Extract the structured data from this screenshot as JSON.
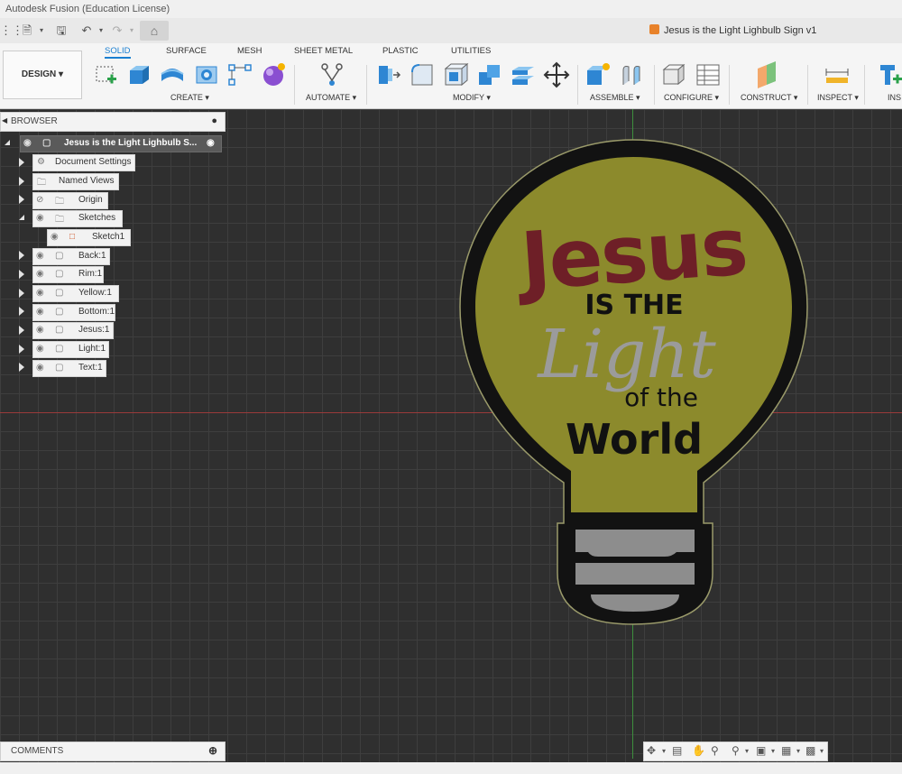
{
  "app": {
    "title": "Autodesk Fusion (Education License)"
  },
  "document": {
    "title": "Jesus is the Light Lighbulb Sign v1"
  },
  "workspace": {
    "label": "DESIGN ▾"
  },
  "tabs": [
    "SOLID",
    "SURFACE",
    "MESH",
    "SHEET METAL",
    "PLASTIC",
    "UTILITIES"
  ],
  "active_tab": "SOLID",
  "groups": {
    "create": "CREATE ▾",
    "automate": "AUTOMATE ▾",
    "modify": "MODIFY ▾",
    "assemble": "ASSEMBLE ▾",
    "configure": "CONFIGURE ▾",
    "construct": "CONSTRUCT ▾",
    "inspect": "INSPECT ▾",
    "insert": "INS"
  },
  "browser": {
    "header": "BROWSER",
    "root": "Jesus is the Light Lighbulb S...",
    "items": {
      "document_settings": "Document Settings",
      "named_views": "Named Views",
      "origin": "Origin",
      "sketches": "Sketches",
      "sketch1": "Sketch1",
      "back": "Back:1",
      "rim": "Rim:1",
      "yellow": "Yellow:1",
      "bottom": "Bottom:1",
      "jesus": "Jesus:1",
      "light": "Light:1",
      "text": "Text:1"
    }
  },
  "comments": {
    "label": "COMMENTS"
  },
  "model": {
    "line1": "Jesus",
    "line2": "IS THE",
    "line3": "Light",
    "line4": "of the",
    "line5": "World",
    "colors": {
      "bulb": "#8b8b2a",
      "rim": "#101010",
      "jesus": "#6e1f27",
      "light": "#9a9a9a",
      "base": "#8f8f8f"
    }
  }
}
